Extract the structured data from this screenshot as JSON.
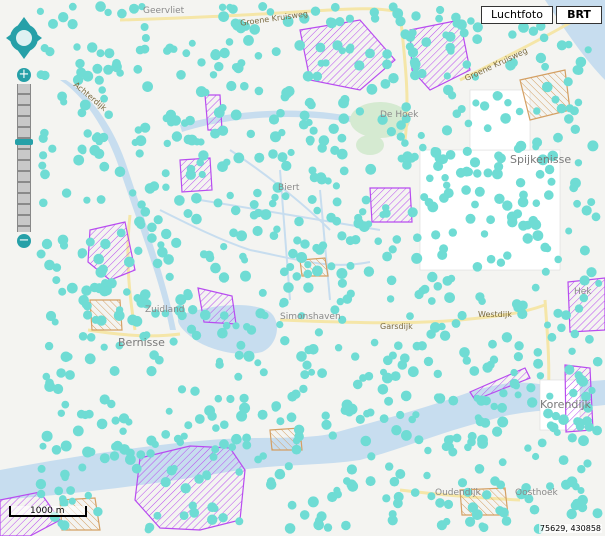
{
  "layers": {
    "aerial_label": "Luchtfoto",
    "brt_label": "BRT"
  },
  "places": {
    "geervliet": "Geervliet",
    "den_hoek": "De Hoek",
    "spijkenisse": "Spijkenisse",
    "biert": "Biert",
    "simonshaven": "Simonshaven",
    "bernisse": "Bernisse",
    "zuidland": "Zuidland",
    "hekelingen": "Hek",
    "korendijk": "Korendijk",
    "oudendijk": "Oudendijk",
    "oosthoek": "Oosthoek"
  },
  "streets": {
    "groene_kruisweg": "Groene Kruisweg",
    "groene_kruisweg_east": "Groene Kruisweg",
    "garsdijk": "Garsdijk",
    "westdijk": "Westdijk",
    "achterdijk": "Achterdijk"
  },
  "scale_label": "1000 m",
  "coordinates": "75629, 430858",
  "colors": {
    "dot": "#6fdcd4",
    "purple": "#b84cf0",
    "orange": "#d4a064",
    "water": "#c7ddef",
    "road": "#f5e6a8"
  }
}
